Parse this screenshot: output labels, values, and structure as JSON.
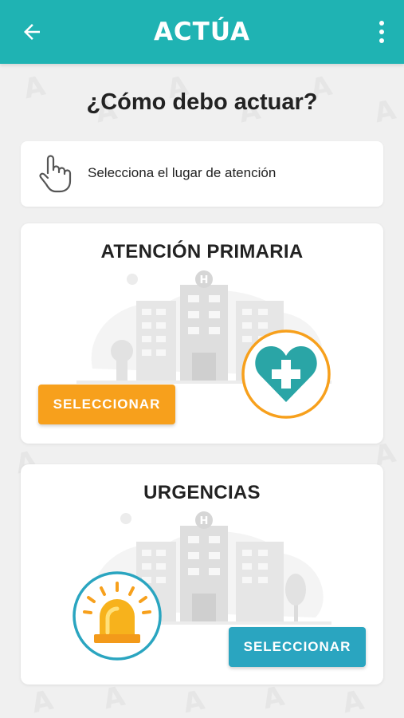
{
  "app": {
    "logo_text": "ACTÚA",
    "back_icon": "arrow-left-icon",
    "menu_icon": "more-vertical-icon",
    "accent_color": "#1fb3b3"
  },
  "page": {
    "title": "¿Cómo debo actuar?",
    "instruction": "Selecciona el lugar de atención",
    "instruction_icon": "hand-pointer-icon"
  },
  "options": [
    {
      "title": "ATENCIÓN PRIMARIA",
      "button_label": "SELECCIONAR",
      "button_color": "#f7a01c",
      "icon": "heart-cross-icon"
    },
    {
      "title": "URGENCIAS",
      "button_label": "SELECCIONAR",
      "button_color": "#2aa5c0",
      "icon": "siren-icon"
    }
  ]
}
